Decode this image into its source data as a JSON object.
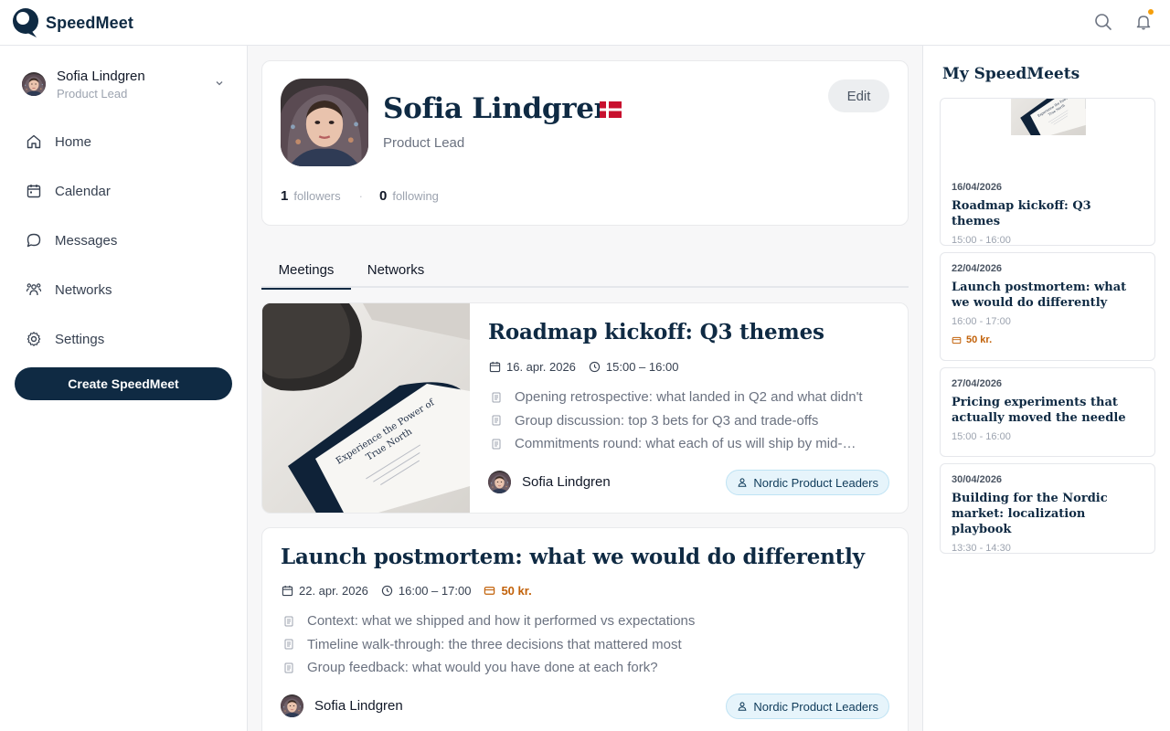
{
  "app": {
    "name": "SpeedMeet"
  },
  "header": {
    "search_icon": "search-icon",
    "bell_icon": "bell-icon",
    "accent_color": "#f59e0b"
  },
  "sidebar": {
    "user": {
      "name": "Sofia Lindgren",
      "role": "Product Lead"
    },
    "items": [
      {
        "label": "Home",
        "icon": "home-icon"
      },
      {
        "label": "Calendar",
        "icon": "calendar-icon"
      },
      {
        "label": "Messages",
        "icon": "message-icon"
      },
      {
        "label": "Networks",
        "icon": "networks-icon"
      },
      {
        "label": "Settings",
        "icon": "gear-icon"
      }
    ],
    "create_label": "Create SpeedMeet",
    "brand_color": "#0f2a43"
  },
  "profile": {
    "name": "Sofia Lindgren",
    "role": "Product Lead",
    "edit_label": "Edit",
    "followers_count": "1",
    "followers_label": "followers",
    "following_count": "0",
    "following_label": "following",
    "flag": "denmark-flag"
  },
  "tabs": [
    {
      "label": "Meetings"
    },
    {
      "label": "Networks"
    }
  ],
  "meetings": [
    {
      "title": "Roadmap kickoff: Q3 themes",
      "date": "16. apr. 2026",
      "time": "15:00 – 16:00",
      "agenda": [
        "Opening retrospective: what landed in Q2 and what didn't",
        "Group discussion: top 3 bets for Q3 and trade-offs",
        "Commitments round: what each of us will ship by mid-…"
      ],
      "host": "Sofia Lindgren",
      "network": "Nordic Product Leaders"
    },
    {
      "title": "Launch postmortem: what we would do differently",
      "date": "22. apr. 2026",
      "time": "16:00 – 17:00",
      "price": "50 kr.",
      "agenda": [
        "Context: what we shipped and how it performed vs expectations",
        "Timeline walk-through: the three decisions that mattered most",
        "Group feedback: what would you have done at each fork?"
      ],
      "host": "Sofia Lindgren",
      "network": "Nordic Product Leaders"
    }
  ],
  "my_speedmeets": {
    "title": "My SpeedMeets",
    "items": [
      {
        "date": "16/04/2026",
        "title": "Roadmap kickoff: Q3 themes",
        "time": "15:00 - 16:00"
      },
      {
        "date": "22/04/2026",
        "title": "Launch postmortem: what we would do differently",
        "time": "16:00 - 17:00",
        "price": "50 kr."
      },
      {
        "date": "27/04/2026",
        "title": "Pricing experiments that actually moved the needle",
        "time": "15:00 - 16:00"
      },
      {
        "date": "30/04/2026",
        "title": "Building for the Nordic market: localization playbook",
        "time": "13:30 - 14:30"
      }
    ]
  }
}
